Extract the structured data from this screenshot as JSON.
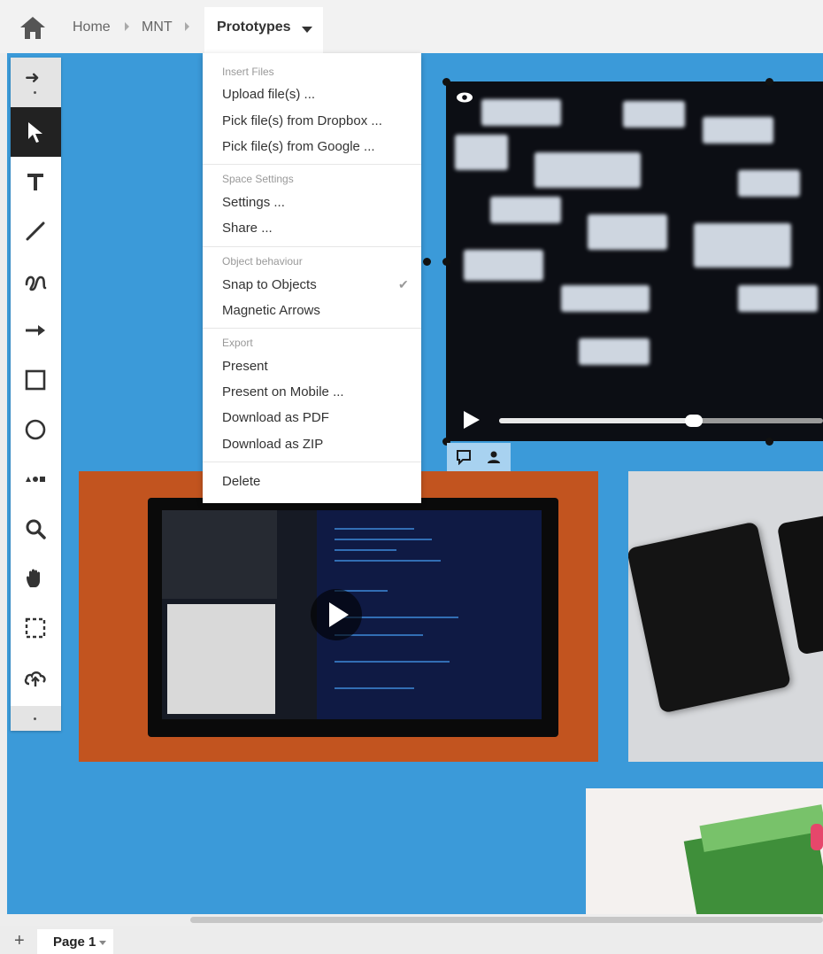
{
  "breadcrumb": {
    "home_icon": "home-icon",
    "items": [
      "Home",
      "MNT"
    ],
    "active": "Prototypes"
  },
  "toolbar": {
    "tools": [
      "select-arrow-icon",
      "text-icon",
      "line-icon",
      "freehand-icon",
      "arrow-icon",
      "rectangle-icon",
      "circle-icon",
      "shapes-icon",
      "search-icon",
      "hand-icon",
      "selection-box-icon",
      "upload-cloud-icon"
    ],
    "active_tool": "select-arrow-icon"
  },
  "menu": {
    "sections": [
      {
        "header": "Insert Files",
        "items": [
          "Upload file(s) ...",
          "Pick file(s) from Dropbox ...",
          "Pick file(s) from Google ..."
        ]
      },
      {
        "header": "Space Settings",
        "items": [
          "Settings ...",
          "Share ..."
        ]
      },
      {
        "header": "Object behaviour",
        "items": [
          "Snap to Objects",
          "Magnetic Arrows"
        ]
      },
      {
        "header": "Export",
        "items": [
          "Present",
          "Present on Mobile ...",
          "Download as PDF",
          "Download as ZIP"
        ]
      },
      {
        "header": "",
        "items": [
          "Delete"
        ]
      }
    ],
    "checked_item": "Snap to Objects"
  },
  "video_player": {
    "progress": 0.6
  },
  "pages": {
    "tabs": [
      "Page 1"
    ]
  },
  "colors": {
    "canvas": "#3b9ad9",
    "toolbar_active": "#222222"
  }
}
